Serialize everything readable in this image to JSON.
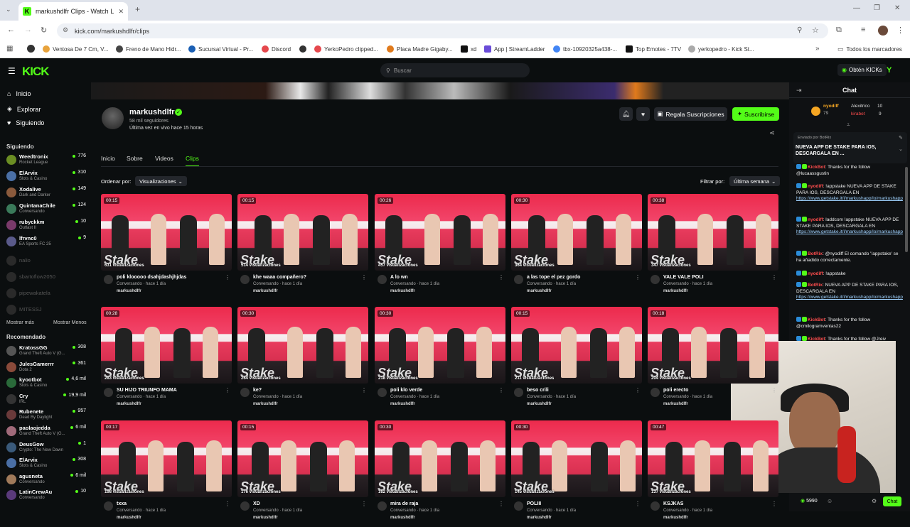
{
  "browser": {
    "tab_title": "markushdlfr Clips - Watch Live ...",
    "url": "kick.com/markushdlfr/clips",
    "bookmarks": [
      "Ventosa De 7 Cm, V...",
      "Freno de Mano Hidr...",
      "Sucursal Virtual - Pr...",
      "Discord",
      "YerkoPedro clipped...",
      "Placa Madre Gigaby...",
      "xd",
      "App | StreamLadder",
      "tbx-10920325a438-...",
      "Top Emotes - 7TV",
      "yerkopedro - Kick St..."
    ],
    "all_bookmarks": "Todos los marcadores"
  },
  "header": {
    "logo": "KICK",
    "search_placeholder": "Buscar",
    "get_kicks": "Obtén KICKs"
  },
  "sidebar": {
    "nav": [
      "Inicio",
      "Explorar",
      "Siguiendo"
    ],
    "following_title": "Siguiendo",
    "following": [
      {
        "name": "Weedtronix",
        "category": "Rocket League",
        "viewers": "776",
        "color": "#6b8e23"
      },
      {
        "name": "ElArvix",
        "category": "Slots & Casino",
        "viewers": "310",
        "color": "#4a6fa5"
      },
      {
        "name": "Xodalive",
        "category": "Dark and Darker",
        "viewers": "149",
        "color": "#8a5a3c"
      },
      {
        "name": "QuintanaChile",
        "category": "Conversando",
        "viewers": "124",
        "color": "#3a7a5a"
      },
      {
        "name": "rubyckkm",
        "category": "Outlast II",
        "viewers": "10",
        "color": "#7a3a6a"
      },
      {
        "name": "lfrvnc0",
        "category": "EA Sports FC 25",
        "viewers": "9",
        "color": "#5a5a8a"
      }
    ],
    "offline": [
      "nalio",
      "sbartoflow2050",
      "pipewakatela",
      "MITESSJ"
    ],
    "show_more": "Mostrar más",
    "show_less": "Mostrar Menos",
    "recommended_title": "Recomendado",
    "recommended": [
      {
        "name": "KratossGG",
        "category": "Grand Theft Auto V (G...",
        "viewers": "308",
        "color": "#555"
      },
      {
        "name": "JulesGamerrr",
        "category": "Dota 2",
        "viewers": "361",
        "color": "#8a4a3a"
      },
      {
        "name": "kyootbot",
        "category": "Slots & Casino",
        "viewers": "4,6 mil",
        "color": "#2a6a3a"
      },
      {
        "name": "Cry",
        "category": "IRL",
        "viewers": "19,9 mil",
        "color": "#333"
      },
      {
        "name": "Rubenete",
        "category": "Dead By Daylight",
        "viewers": "957",
        "color": "#6a3a3a"
      },
      {
        "name": "paolaojedda",
        "category": "Grand Theft Auto V (G...",
        "viewers": "6 mil",
        "color": "#a06a7a"
      },
      {
        "name": "DeusGow",
        "category": "Crypto: The New Dawn",
        "viewers": "1",
        "color": "#3a5a7a"
      },
      {
        "name": "ElArvix",
        "category": "Slots & Casino",
        "viewers": "308",
        "color": "#4a6fa5"
      },
      {
        "name": "agusneta",
        "category": "Conversando",
        "viewers": "6 mil",
        "color": "#a07a5a"
      },
      {
        "name": "LatinCrewAu",
        "category": "Conversando",
        "viewers": "10",
        "color": "#5a3a7a"
      }
    ]
  },
  "channel": {
    "name": "markushdlfr",
    "followers": "58 mil seguidores",
    "last_live": "Última vez en vivo hace 15 horas",
    "gift_subs": "Regala Suscripciones",
    "subscribe": "Suscribirse",
    "tabs": [
      "Inicio",
      "Sobre",
      "Videos",
      "Clips"
    ],
    "active_tab": "Clips",
    "sort_label": "Ordenar por:",
    "sort_value": "Visualizaciones",
    "filter_label": "Filtrar por:",
    "filter_value": "Última semana"
  },
  "clips": [
    {
      "duration": "00:15",
      "views": "631 visualizaciones",
      "title": "poli klooooo dsahjdashjhjdas",
      "meta": "Conversando · hace 1 día",
      "author": "markushdlfr"
    },
    {
      "duration": "00:15",
      "views": "514 visualizaciones",
      "title": "khe waaa compañero?",
      "meta": "Conversando · hace 1 día",
      "author": "markushdlfr"
    },
    {
      "duration": "00:26",
      "views": "457 visualizaciones",
      "title": "A lo wn",
      "meta": "Conversando · hace 1 día",
      "author": "markushdlfr"
    },
    {
      "duration": "00:30",
      "views": "364 visualizaciones",
      "title": "a las tope el pez gordo",
      "meta": "Conversando · hace 1 día",
      "author": "markushdlfr"
    },
    {
      "duration": "00:38",
      "views": "347 visualizaciones",
      "title": "VALE VALE POLI",
      "meta": "Conversando · hace 1 día",
      "author": "markushdlfr"
    },
    {
      "duration": "00:28",
      "views": "283 visualizaciones",
      "title": "SU HIJO TRIUNFO MAMA",
      "meta": "Conversando · hace 1 día",
      "author": "markushdlfr"
    },
    {
      "duration": "00:30",
      "views": "264 visualizaciones",
      "title": "ke?",
      "meta": "Conversando · hace 1 día",
      "author": "markushdlfr"
    },
    {
      "duration": "00:30",
      "views": "218 visualizaciones",
      "title": "poli klo verde",
      "meta": "Conversando · hace 1 día",
      "author": "markushdlfr"
    },
    {
      "duration": "00:15",
      "views": "211 visualizaciones",
      "title": "beso crili",
      "meta": "Conversando · hace 1 día",
      "author": "markushdlfr"
    },
    {
      "duration": "00:18",
      "views": "204 visualizaciones",
      "title": "poli erecto",
      "meta": "Conversando · hace 1 día",
      "author": "markushdlfr"
    },
    {
      "duration": "00:17",
      "views": "198 visualizaciones",
      "title": "txxa",
      "meta": "Conversando · hace 1 día",
      "author": "markushdlfr"
    },
    {
      "duration": "00:15",
      "views": "176 visualizaciones",
      "title": "XD",
      "meta": "Conversando · hace 1 día",
      "author": "markushdlfr"
    },
    {
      "duration": "00:30",
      "views": "162 visualizaciones",
      "title": "mira de raja",
      "meta": "Conversando · hace 1 día",
      "author": "markushdlfr"
    },
    {
      "duration": "00:30",
      "views": "145 visualizaciones",
      "title": "POLIII",
      "meta": "Conversando · hace 1 día",
      "author": "markushdlfr"
    },
    {
      "duration": "00:47",
      "views": "137 visualizaciones",
      "title": "KSJKAS",
      "meta": "Conversando · hace 1 día",
      "author": "markushdlfr"
    }
  ],
  "chat": {
    "title": "Chat",
    "leaderboard": [
      {
        "name": "nyodiff",
        "points": "79",
        "color": "#f5a623"
      },
      {
        "name": "Alexitrico",
        "points": "10",
        "color": "#ddd"
      },
      {
        "name": "kirabet",
        "points": "9",
        "color": "#ff4d4d"
      }
    ],
    "pinned_by": "Enviado por BotRix",
    "pinned_msg": "NUEVA APP DE STAKE PARA IOS, DESCARGALA EN ...",
    "messages": [
      {
        "user": "KickBot",
        "color": "#ff4d4d",
        "text": "Thanks for the follow @lucaassgustin"
      },
      {
        "user": "nyodiff",
        "color": "#ff4d4d",
        "text": "!appstake NUEVA APP DE STAKE PARA IOS, DESCARGALA EN",
        "link": "https://www.getstake.it/l/markushapp/lo/markushapp"
      },
      {
        "user": "nyodiff",
        "color": "#ff4d4d",
        "text": "laddcom !appstake NUEVA APP DE STAKE PARA IOS, DESCARGALA EN",
        "link": "https://www.getstake.it/l/markushapp/lo/markushapp"
      },
      {
        "user": "BotRix",
        "color": "#ff4d4d",
        "text": "@nyodiff El comando '!appstake' se ha añadido correctamente."
      },
      {
        "user": "nyodiff",
        "color": "#ff4d4d",
        "text": "!appstake"
      },
      {
        "user": "BotRix",
        "color": "#ff4d4d",
        "text": "NUEVA APP DE STAKE PARA IOS, DESCARGALA EN",
        "link": "https://www.getstake.it/l/markushapp/lo/markushapp"
      },
      {
        "user": "KickBot",
        "color": "#ff4d4d",
        "text": "Thanks for the follow @cmilogramventas22"
      },
      {
        "user": "KickBot",
        "color": "#ff4d4d",
        "text": "Thanks for the follow @Jreiv"
      }
    ],
    "points": "5990",
    "chat_button": "Chat"
  }
}
